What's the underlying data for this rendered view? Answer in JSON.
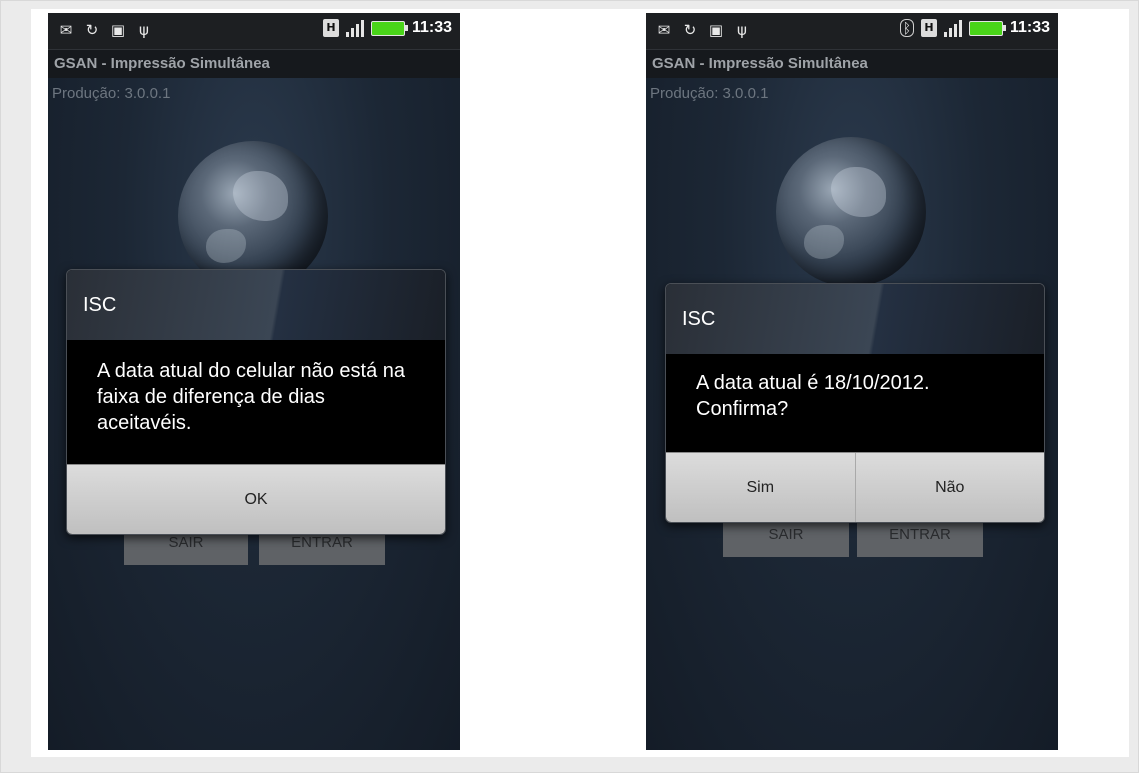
{
  "left": {
    "statusbar": {
      "time": "11:33",
      "h_label": "H"
    },
    "app_title": "GSAN - Impressão Simultânea",
    "version": "Produção: 3.0.0.1",
    "background_buttons": [
      "SAIR",
      "ENTRAR"
    ],
    "dialog": {
      "title": "ISC",
      "message": "A data atual do celular não está na faixa de diferença de dias aceitavéis.",
      "buttons": [
        "OK"
      ]
    }
  },
  "right": {
    "statusbar": {
      "time": "11:33",
      "h_label": "H"
    },
    "app_title": "GSAN - Impressão Simultânea",
    "version": "Produção: 3.0.0.1",
    "background_buttons": [
      "SAIR",
      "ENTRAR"
    ],
    "dialog": {
      "title": "ISC",
      "message": "A data atual é 18/10/2012. Confirma?",
      "buttons": [
        "Sim",
        "Não"
      ]
    }
  },
  "icons": {
    "statusbar_left": [
      "mail-icon",
      "sync-icon",
      "photo-icon",
      "usb-icon"
    ],
    "statusbar_right_left_phone": [
      "h-network-icon",
      "signal-icon",
      "battery-icon"
    ],
    "statusbar_right_right_phone": [
      "bluetooth-icon",
      "h-network-icon",
      "signal-icon",
      "battery-icon"
    ]
  },
  "colors": {
    "battery": "#49d419",
    "dialog_body": "#000000",
    "button_bar": "#d0d0d0",
    "phone_bg": "#1c2735"
  }
}
